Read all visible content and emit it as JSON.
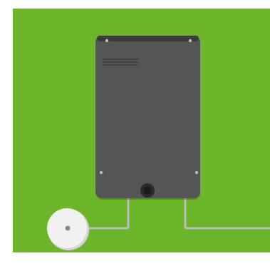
{
  "scene": {
    "background_color": "#6db52a",
    "device": {
      "body_color": "#555555",
      "edge_color": "#3e3e3e",
      "top_bar_color": "#3a3a3a",
      "vent_color": "#444444",
      "screw_color": "#bdbdbd",
      "button_ring_color": "#2b2b2b",
      "button_color": "#1b1b1b"
    },
    "cable_color": "#bcbcbc",
    "sensor": {
      "pad_color": "#f1f1f1",
      "pad_shadow_color": "#d6d6d6",
      "connector_color": "#8a8a8a"
    }
  }
}
